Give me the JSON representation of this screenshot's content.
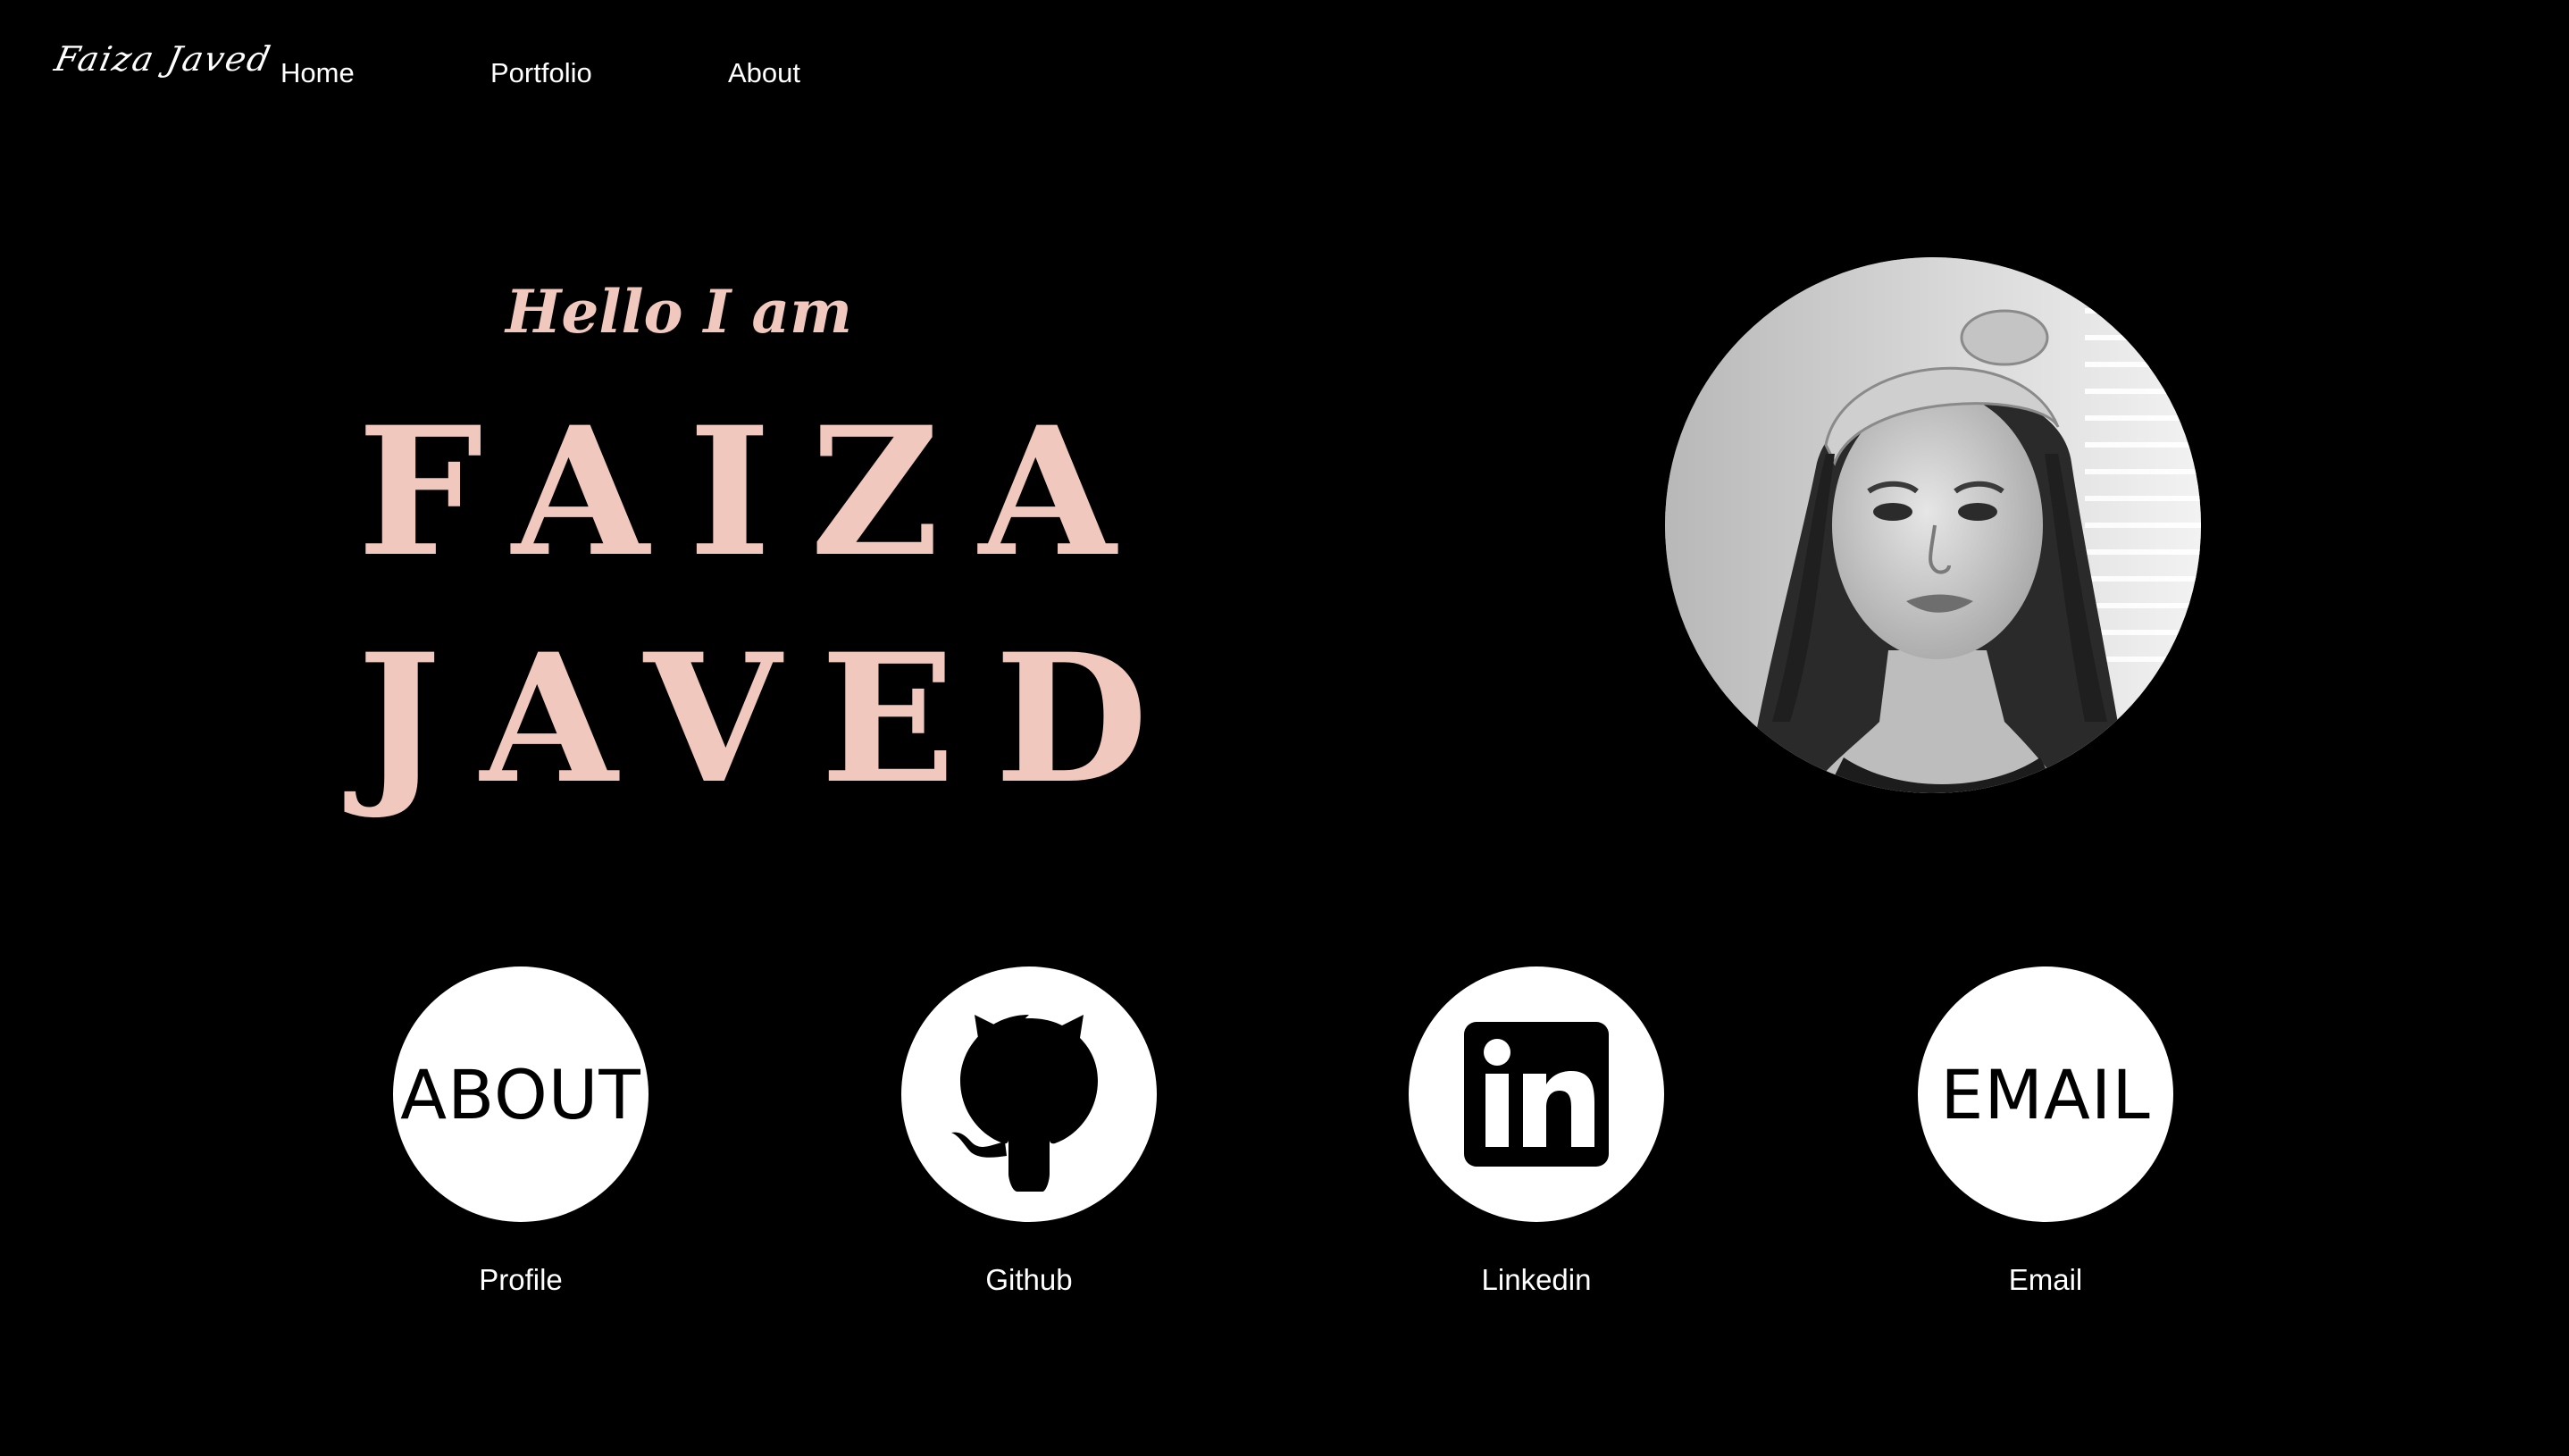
{
  "header": {
    "logo_text": "Faiza Javed",
    "nav": [
      {
        "label": "Home"
      },
      {
        "label": "Portfolio"
      },
      {
        "label": "About"
      }
    ]
  },
  "hero": {
    "greeting": "Hello I am",
    "first_name": "FAIZA",
    "last_name": "JAVED",
    "accent_color": "#f0c8bd",
    "photo_icon": "profile-photo"
  },
  "social": [
    {
      "circle_text": "ABOUT",
      "label": "Profile",
      "icon": "about-icon"
    },
    {
      "circle_text": "",
      "label": "Github",
      "icon": "github-icon"
    },
    {
      "circle_text": "",
      "label": "Linkedin",
      "icon": "linkedin-icon"
    },
    {
      "circle_text": "EMAIL",
      "label": "Email",
      "icon": "email-icon"
    }
  ],
  "colors": {
    "background": "#000000",
    "text": "#ffffff",
    "accent": "#f0c8bd"
  }
}
